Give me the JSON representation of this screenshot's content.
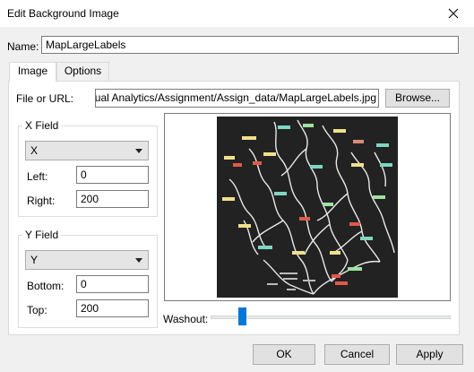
{
  "window": {
    "title": "Edit Background Image"
  },
  "name_field": {
    "label": "Name:",
    "value": "MapLargeLabels"
  },
  "tabs": [
    {
      "label": "Image",
      "active": true
    },
    {
      "label": "Options",
      "active": false
    }
  ],
  "file": {
    "label": "File or URL:",
    "value": "wnloads/Visual Analytics/Assignment/Assign_data/MapLargeLabels.jpg",
    "browse_label": "Browse..."
  },
  "x_field": {
    "group_label": "X Field",
    "selected": "X",
    "left_label": "Left:",
    "left_value": "0",
    "right_label": "Right:",
    "right_value": "200"
  },
  "y_field": {
    "group_label": "Y Field",
    "selected": "Y",
    "bottom_label": "Bottom:",
    "bottom_value": "0",
    "top_label": "Top:",
    "top_value": "200"
  },
  "washout": {
    "label": "Washout:",
    "value_fraction": 0.12
  },
  "buttons": {
    "ok": "OK",
    "cancel": "Cancel",
    "apply": "Apply"
  },
  "colors": {
    "accent": "#0078d7",
    "map_bg": "#222222",
    "river": "#e8e8e8"
  },
  "icons": {
    "close": "close-icon",
    "dropdown": "chevron-down-icon"
  }
}
